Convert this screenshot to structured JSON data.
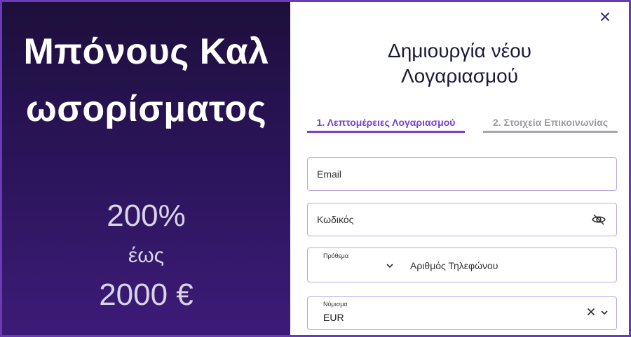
{
  "promo": {
    "title": "Μπόνους Καλωσορίσματος",
    "amount": "200%",
    "upto": "έως",
    "max": "2000 €"
  },
  "form": {
    "title_line1": "Δημιουργία νέου",
    "title_line2": "Λογαριασμού",
    "tabs": [
      {
        "label": "1. Λεπτομέρειες Λογαριασμού",
        "active": true
      },
      {
        "label": "2. Στοιχεία Επικοινωνίας",
        "active": false
      }
    ],
    "email_placeholder": "Email",
    "password_placeholder": "Κωδικός",
    "prefix_label": "Πρόθεμα",
    "phone_placeholder": "Αριθμός Τηλεφώνου",
    "currency_label": "Νόμισμα",
    "currency_value": "EUR"
  },
  "icons": {
    "close": "close-icon",
    "password_toggle": "eye-slash-icon",
    "chevron": "chevron-down-icon",
    "clear": "clear-icon"
  },
  "colors": {
    "accent": "#7b3fd0",
    "promo_bg": "#2a1458",
    "field_border": "#b8a6e8",
    "heading": "#1c1a3a"
  }
}
